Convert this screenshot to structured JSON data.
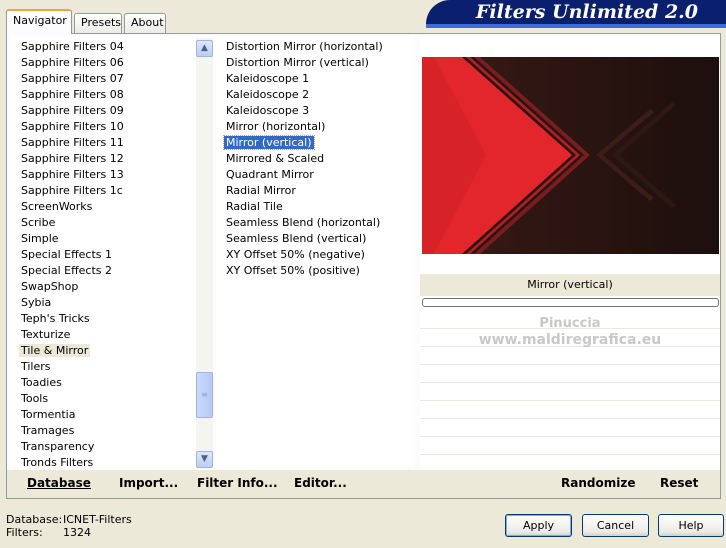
{
  "tabs": [
    {
      "label": "Navigator",
      "active": true
    },
    {
      "label": "Presets",
      "active": false
    },
    {
      "label": "About",
      "active": false
    }
  ],
  "banner": "Filters Unlimited 2.0",
  "categories": {
    "items": [
      "Sapphire Filters 04",
      "Sapphire Filters 06",
      "Sapphire Filters 07",
      "Sapphire Filters 08",
      "Sapphire Filters 09",
      "Sapphire Filters 10",
      "Sapphire Filters 11",
      "Sapphire Filters 12",
      "Sapphire Filters 13",
      "Sapphire Filters 1c",
      "ScreenWorks",
      "Scribe",
      "Simple",
      "Special Effects 1",
      "Special Effects 2",
      "SwapShop",
      "Sybia",
      "Teph's Tricks",
      "Texturize",
      "Tile & Mirror",
      "Tilers",
      "Toadies",
      "Tools",
      "Tormentia",
      "Tramages",
      "Transparency",
      "Tronds Filters"
    ],
    "selected": "Tile & Mirror"
  },
  "filters": {
    "items": [
      "Distortion Mirror (horizontal)",
      "Distortion Mirror (vertical)",
      "Kaleidoscope 1",
      "Kaleidoscope 2",
      "Kaleidoscope 3",
      "Mirror (horizontal)",
      "Mirror (vertical)",
      "Mirrored & Scaled",
      "Quadrant Mirror",
      "Radial Mirror",
      "Radial Tile",
      "Seamless Blend (horizontal)",
      "Seamless Blend (vertical)",
      "XY Offset 50% (negative)",
      "XY Offset 50% (positive)"
    ],
    "selected": "Mirror (vertical)"
  },
  "preview": {
    "caption": "Mirror (vertical)",
    "watermark_line1": "Pinuccia",
    "watermark_line2": "www.maldiregrafica.eu",
    "colors": {
      "red": "#e2262b",
      "dark": "#2a1410",
      "stripe": "#c81f24"
    }
  },
  "toolbar": {
    "database": "Database",
    "import": "Import...",
    "filter_info": "Filter Info...",
    "editor": "Editor...",
    "randomize": "Randomize",
    "reset": "Reset"
  },
  "status": {
    "database_label": "Database:",
    "database_value": "ICNET-Filters",
    "filters_label": "Filters:",
    "filters_value": "1324"
  },
  "buttons": {
    "apply": "Apply",
    "cancel": "Cancel",
    "help": "Help"
  }
}
